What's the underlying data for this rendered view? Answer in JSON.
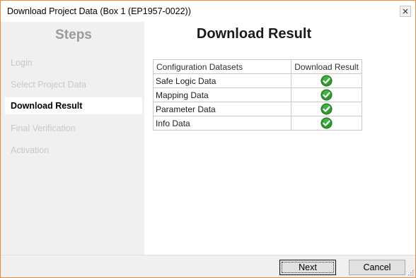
{
  "window": {
    "title": "Download Project Data (Box 1 (EP1957-0022))",
    "close_icon": "close-icon"
  },
  "sidebar": {
    "heading": "Steps",
    "items": [
      {
        "label": "Login",
        "state": "inactive"
      },
      {
        "label": "Select Project Data",
        "state": "inactive"
      },
      {
        "label": "Download Result",
        "state": "active"
      },
      {
        "label": "Final Verification",
        "state": "inactive"
      },
      {
        "label": "Activation",
        "state": "inactive"
      }
    ]
  },
  "main": {
    "heading": "Download Result",
    "table": {
      "columns": [
        "Configuration Datasets",
        "Download Result"
      ],
      "rows": [
        {
          "name": "Safe Logic Data",
          "result": "success",
          "result_icon": "check-circle-icon"
        },
        {
          "name": "Mapping Data",
          "result": "success",
          "result_icon": "check-circle-icon"
        },
        {
          "name": "Parameter Data",
          "result": "success",
          "result_icon": "check-circle-icon"
        },
        {
          "name": "Info Data",
          "result": "success",
          "result_icon": "check-circle-icon"
        }
      ]
    }
  },
  "footer": {
    "next_label": "Next",
    "cancel_label": "Cancel"
  },
  "colors": {
    "window_border": "#ee8a3a",
    "success_green": "#2e9a2e",
    "inactive_text": "#c8c8c8"
  }
}
